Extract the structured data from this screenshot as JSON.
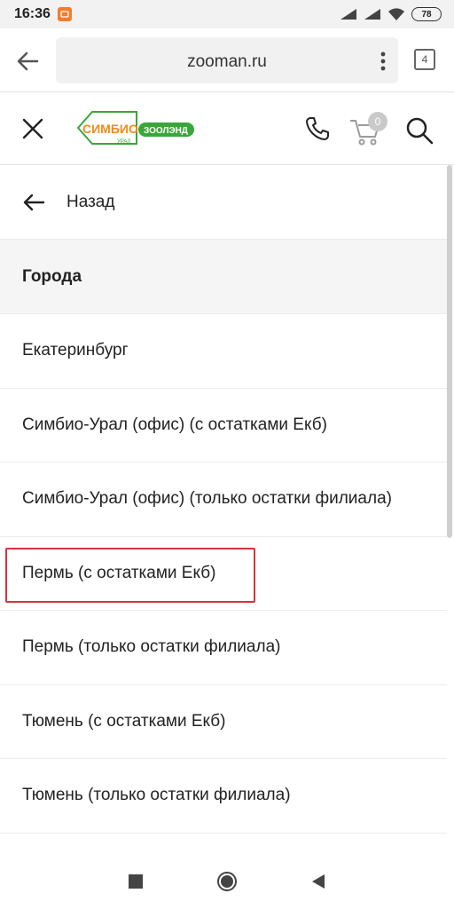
{
  "status": {
    "time": "16:36",
    "battery": "78"
  },
  "browser": {
    "url": "zooman.ru",
    "tabs_count": "4"
  },
  "header": {
    "logo_primary": "СИМБИО",
    "logo_sub": "УРАЛ",
    "logo_secondary": "ЗООЛЭНД",
    "cart_count": "0",
    "colors": {
      "logo_orange": "#f08a1c",
      "logo_green": "#3aa63a"
    }
  },
  "menu": {
    "back_label": "Назад",
    "section_title": "Города",
    "items": [
      "Екатеринбург",
      "Симбио-Урал (офис) (с остатками Екб)",
      "Симбио-Урал (офис) (только остатки филиала)",
      "Пермь (с остатками Екб)",
      "Пермь (только остатки филиала)",
      "Тюмень (с остатками Екб)",
      "Тюмень (только остатки филиала)"
    ]
  },
  "icons": [
    "back-arrow-icon",
    "more-vert-icon",
    "close-icon",
    "phone-icon",
    "cart-icon",
    "search-icon",
    "nav-square-icon",
    "nav-circle-icon",
    "nav-triangle-icon"
  ],
  "highlight_color": "#d9323b"
}
